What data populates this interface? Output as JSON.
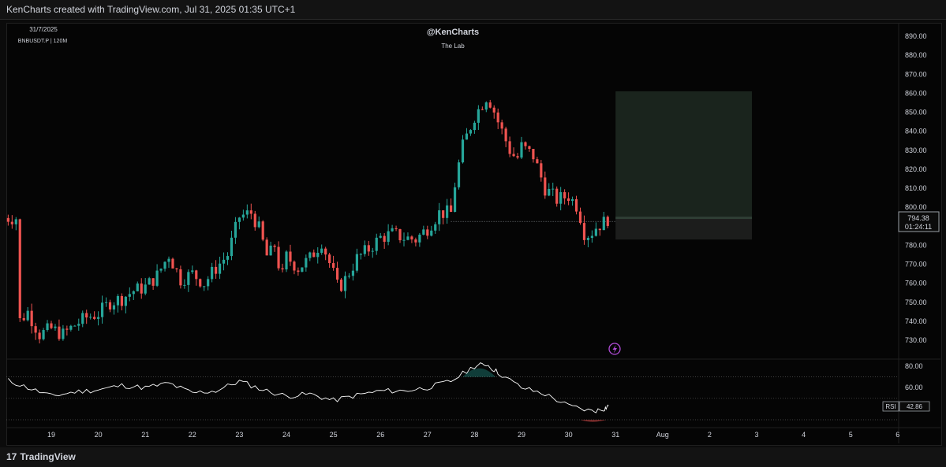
{
  "header": {
    "credit": "KenCharts created with TradingView.com, Jul 31, 2025 01:35 UTC+1"
  },
  "footer": {
    "logo_text": "TradingView",
    "logo_mark": "17"
  },
  "chart_info": {
    "date": "31/7/2025",
    "symbol": "BNBUSDT.P | 120M",
    "author": "@KenCharts",
    "subtitle": "The Lab"
  },
  "price_label": {
    "value": "794.38",
    "countdown": "01:24:11",
    "color": "#26a69a"
  },
  "rsi_label": {
    "name": "RSI",
    "value": "42.86"
  },
  "colors": {
    "up": "#26a69a",
    "down": "#ef5350",
    "background": "#050505",
    "position_box": "#1e2a22",
    "rsi_line": "#ffffff"
  },
  "icons": {
    "alert": "lightning-icon"
  },
  "chart_data": [
    {
      "type": "candlestick",
      "title": "BNBUSDT.P",
      "x_ticks": [
        "19",
        "20",
        "21",
        "22",
        "23",
        "24",
        "25",
        "26",
        "27",
        "28",
        "29",
        "30",
        "31",
        "Aug",
        "2",
        "3",
        "4",
        "5",
        "6"
      ],
      "y_ticks": [
        "730.00",
        "740.00",
        "750.00",
        "760.00",
        "770.00",
        "780.00",
        "790.00",
        "800.00",
        "810.00",
        "820.00",
        "830.00",
        "840.00",
        "850.00",
        "860.00",
        "870.00",
        "880.00",
        "890.00"
      ],
      "ylim": [
        724,
        894
      ],
      "approx_path": [
        {
          "day": 18.25,
          "price": 738
        },
        {
          "day": 18.5,
          "price": 745
        },
        {
          "day": 18.75,
          "price": 733
        },
        {
          "day": 19.0,
          "price": 736
        },
        {
          "day": 19.25,
          "price": 733
        },
        {
          "day": 19.5,
          "price": 738
        },
        {
          "day": 19.75,
          "price": 742
        },
        {
          "day": 20.0,
          "price": 744
        },
        {
          "day": 20.25,
          "price": 750
        },
        {
          "day": 20.5,
          "price": 752
        },
        {
          "day": 20.75,
          "price": 756
        },
        {
          "day": 21.0,
          "price": 758
        },
        {
          "day": 21.25,
          "price": 764
        },
        {
          "day": 21.5,
          "price": 775
        },
        {
          "day": 21.75,
          "price": 762
        },
        {
          "day": 22.0,
          "price": 765
        },
        {
          "day": 22.25,
          "price": 760
        },
        {
          "day": 22.5,
          "price": 768
        },
        {
          "day": 22.75,
          "price": 775
        },
        {
          "day": 23.0,
          "price": 795
        },
        {
          "day": 23.25,
          "price": 797
        },
        {
          "day": 23.4,
          "price": 790
        },
        {
          "day": 23.6,
          "price": 773
        },
        {
          "day": 23.75,
          "price": 780
        },
        {
          "day": 23.9,
          "price": 762
        },
        {
          "day": 24.0,
          "price": 774
        },
        {
          "day": 24.25,
          "price": 768
        },
        {
          "day": 24.5,
          "price": 773
        },
        {
          "day": 24.75,
          "price": 782
        },
        {
          "day": 25.0,
          "price": 765
        },
        {
          "day": 25.1,
          "price": 757
        },
        {
          "day": 25.25,
          "price": 762
        },
        {
          "day": 25.5,
          "price": 773
        },
        {
          "day": 25.75,
          "price": 778
        },
        {
          "day": 26.0,
          "price": 784
        },
        {
          "day": 26.25,
          "price": 786
        },
        {
          "day": 26.5,
          "price": 784
        },
        {
          "day": 26.75,
          "price": 783
        },
        {
          "day": 27.0,
          "price": 789
        },
        {
          "day": 27.25,
          "price": 797
        },
        {
          "day": 27.5,
          "price": 797
        },
        {
          "day": 27.6,
          "price": 815
        },
        {
          "day": 27.75,
          "price": 832
        },
        {
          "day": 28.0,
          "price": 848
        },
        {
          "day": 28.25,
          "price": 858
        },
        {
          "day": 28.35,
          "price": 855
        },
        {
          "day": 28.5,
          "price": 845
        },
        {
          "day": 28.75,
          "price": 830
        },
        {
          "day": 28.9,
          "price": 825
        },
        {
          "day": 29.0,
          "price": 832
        },
        {
          "day": 29.25,
          "price": 827
        },
        {
          "day": 29.5,
          "price": 810
        },
        {
          "day": 29.75,
          "price": 804
        },
        {
          "day": 30.0,
          "price": 806
        },
        {
          "day": 30.2,
          "price": 800
        },
        {
          "day": 30.35,
          "price": 785
        },
        {
          "day": 30.5,
          "price": 787
        },
        {
          "day": 30.6,
          "price": 790
        },
        {
          "day": 30.75,
          "price": 792
        },
        {
          "day": 30.85,
          "price": 794.38
        }
      ],
      "position_box": {
        "entry": 794.38,
        "target": 861,
        "stop": 783,
        "from_day": 31.0,
        "to_day": 33.9
      }
    },
    {
      "type": "line",
      "title": "RSI",
      "y_ticks": [
        "60.00",
        "80.00"
      ],
      "levels": [
        70,
        50,
        30
      ],
      "approx_points": [
        {
          "day": 18.0,
          "value": 68
        },
        {
          "day": 18.5,
          "value": 60
        },
        {
          "day": 19.0,
          "value": 52
        },
        {
          "day": 19.5,
          "value": 56
        },
        {
          "day": 20.0,
          "value": 58
        },
        {
          "day": 20.5,
          "value": 62
        },
        {
          "day": 21.0,
          "value": 60
        },
        {
          "day": 21.5,
          "value": 64
        },
        {
          "day": 22.0,
          "value": 55
        },
        {
          "day": 22.5,
          "value": 57
        },
        {
          "day": 23.0,
          "value": 66
        },
        {
          "day": 23.5,
          "value": 58
        },
        {
          "day": 24.0,
          "value": 52
        },
        {
          "day": 24.5,
          "value": 54
        },
        {
          "day": 25.0,
          "value": 48
        },
        {
          "day": 25.5,
          "value": 53
        },
        {
          "day": 26.0,
          "value": 57
        },
        {
          "day": 26.5,
          "value": 57
        },
        {
          "day": 27.0,
          "value": 60
        },
        {
          "day": 27.5,
          "value": 66
        },
        {
          "day": 28.0,
          "value": 80
        },
        {
          "day": 28.25,
          "value": 82
        },
        {
          "day": 28.5,
          "value": 74
        },
        {
          "day": 29.0,
          "value": 60
        },
        {
          "day": 29.5,
          "value": 54
        },
        {
          "day": 30.0,
          "value": 43
        },
        {
          "day": 30.5,
          "value": 38
        },
        {
          "day": 30.75,
          "value": 40
        },
        {
          "day": 30.85,
          "value": 42.86
        }
      ]
    }
  ]
}
